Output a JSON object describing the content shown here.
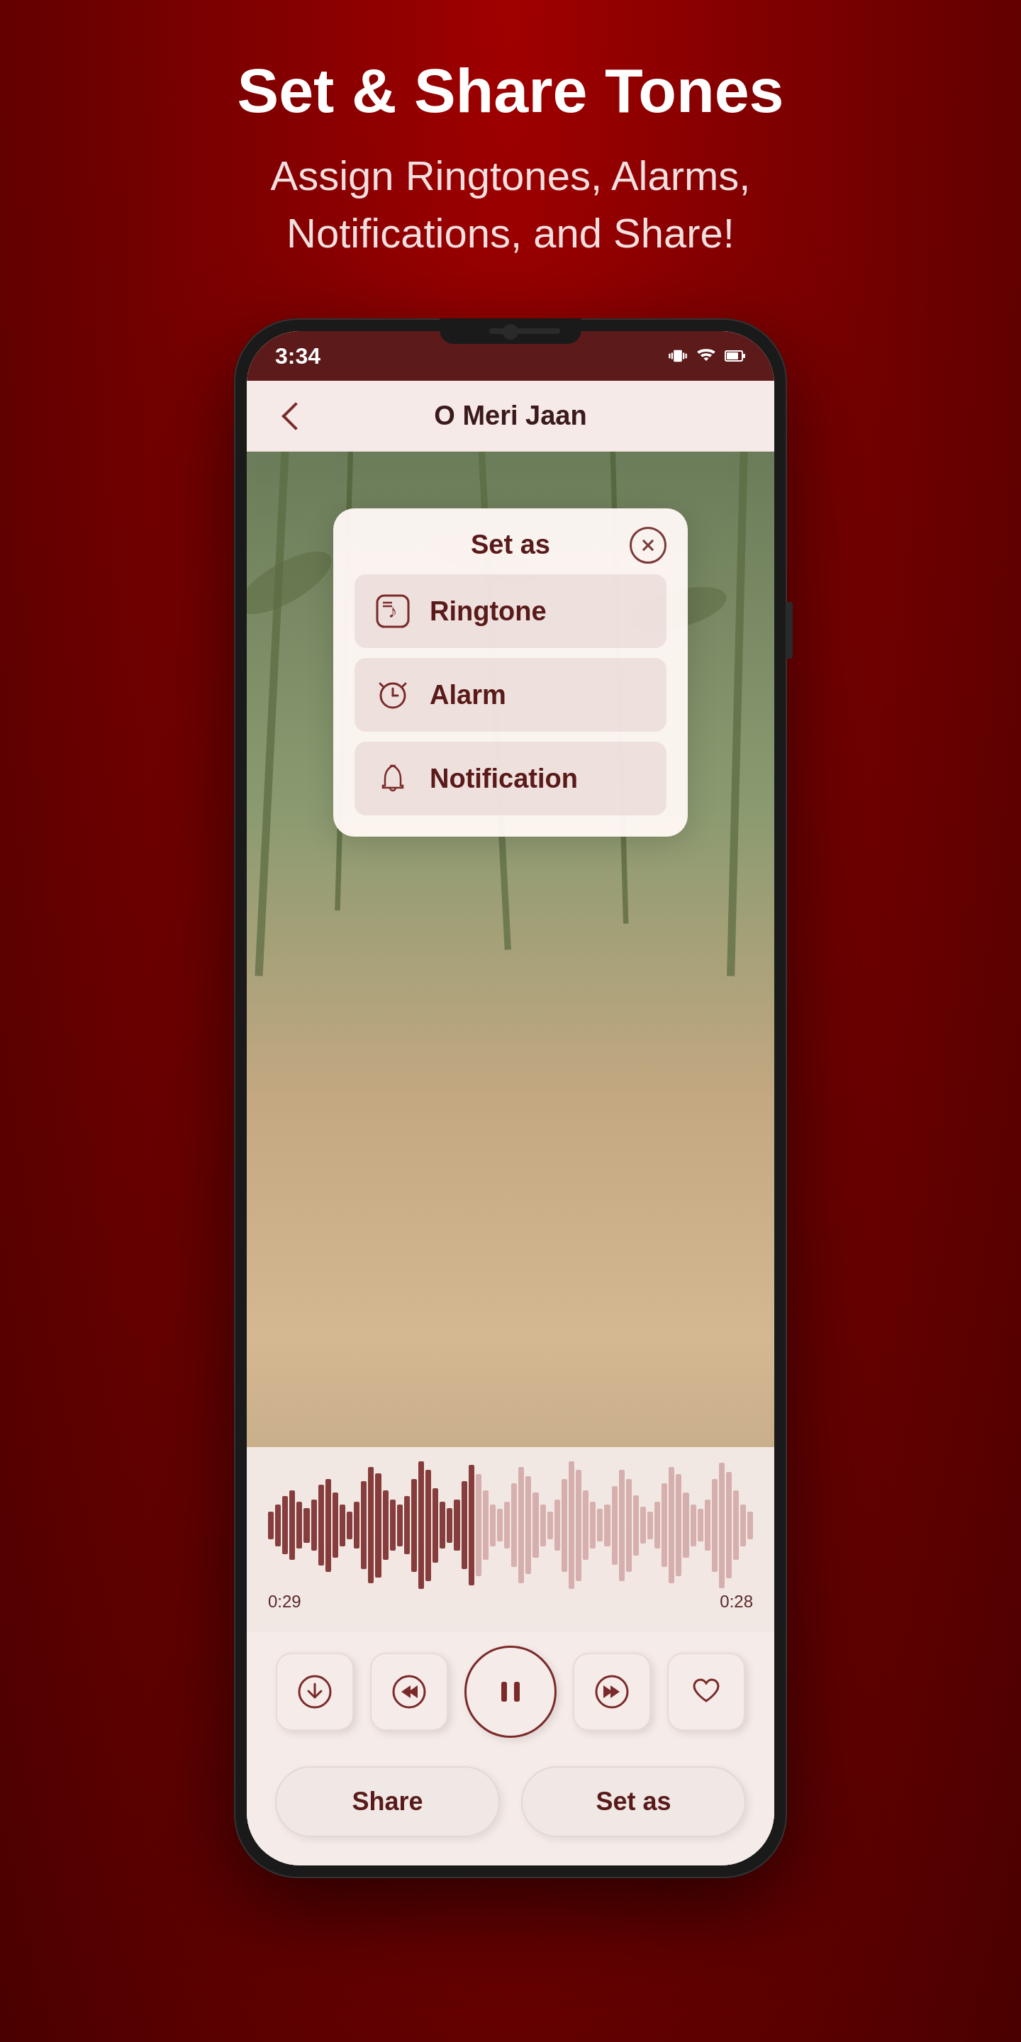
{
  "page": {
    "background_color": "#8B0000"
  },
  "header": {
    "title": "Set & Share Tones",
    "subtitle_line1": "Assign Ringtones, Alarms,",
    "subtitle_line2": "Notifications, and Share!"
  },
  "status_bar": {
    "time": "3:34",
    "icons": [
      "vibrate",
      "wifi",
      "battery"
    ]
  },
  "app_bar": {
    "title": "O Meri Jaan",
    "back_label": "back"
  },
  "dialog": {
    "title": "Set as",
    "close_label": "close",
    "options": [
      {
        "id": "ringtone",
        "label": "Ringtone",
        "icon": "music-note-icon"
      },
      {
        "id": "alarm",
        "label": "Alarm",
        "icon": "alarm-icon"
      },
      {
        "id": "notification",
        "label": "Notification",
        "icon": "bell-icon"
      }
    ]
  },
  "waveform": {
    "time_start": "0:29",
    "time_end": "0:28",
    "bars": [
      12,
      18,
      25,
      30,
      20,
      15,
      22,
      35,
      40,
      28,
      18,
      12,
      20,
      38,
      50,
      45,
      30,
      22,
      18,
      25,
      40,
      55,
      48,
      32,
      20,
      15,
      22,
      38,
      52,
      44,
      30,
      18,
      14,
      20,
      36,
      50,
      42,
      28,
      18,
      12,
      22,
      40,
      55,
      48,
      30,
      20,
      14,
      18,
      34,
      48,
      40,
      26,
      16,
      12,
      20,
      36,
      50,
      44,
      28,
      18,
      14,
      22,
      40,
      54,
      46,
      30,
      18,
      12
    ]
  },
  "controls": {
    "download_label": "download",
    "rewind_label": "rewind",
    "pause_label": "pause",
    "forward_label": "forward",
    "favorite_label": "favorite"
  },
  "bottom_actions": {
    "share_label": "Share",
    "set_as_label": "Set as"
  }
}
